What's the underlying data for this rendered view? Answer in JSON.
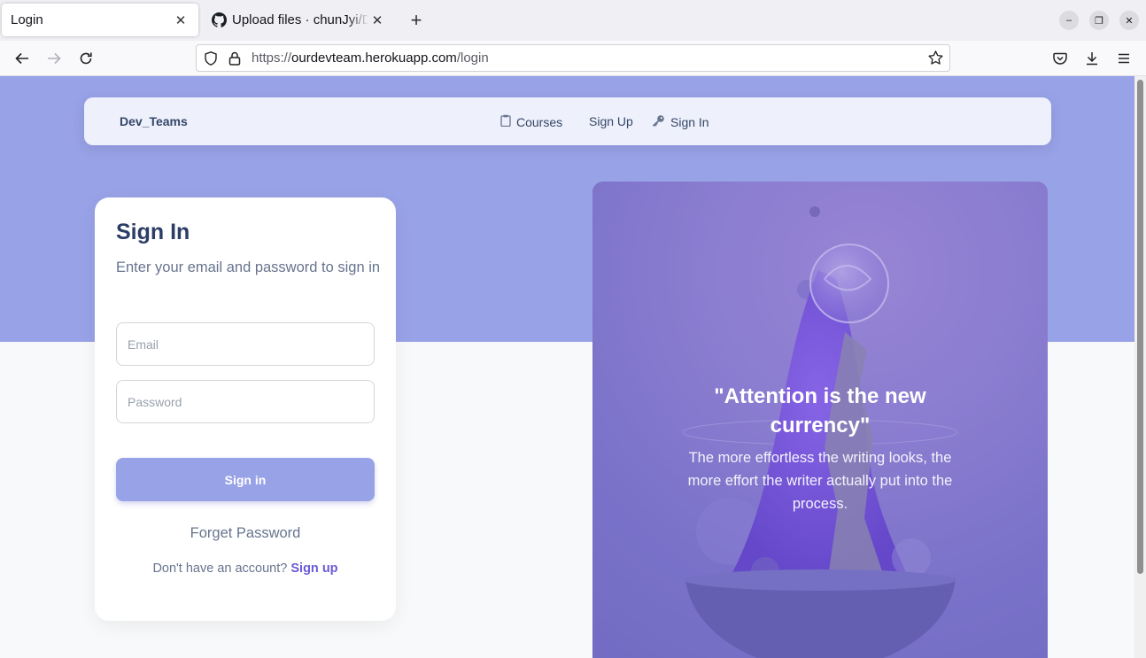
{
  "browser": {
    "tabs": [
      {
        "title": "Login",
        "active": true,
        "icon": "page-icon"
      },
      {
        "title": "Upload files · chunJyi/Dev",
        "active": false,
        "icon": "github-icon"
      }
    ],
    "url": {
      "scheme": "https://",
      "host": "ourdevteam.herokuapp.com",
      "path": "/login"
    }
  },
  "site": {
    "brand": "Dev_Teams",
    "nav": {
      "courses": "Courses",
      "signup": "Sign Up",
      "signin": "Sign In"
    }
  },
  "login": {
    "title": "Sign In",
    "subtitle": "Enter your email and password to sign in",
    "email_placeholder": "Email",
    "password_placeholder": "Password",
    "submit_label": "Sign in",
    "forgot_label": "Forget Password",
    "no_account_text": "Don't have an account?",
    "signup_link": "Sign up"
  },
  "promo": {
    "quote": "\"Attention is the new currency\"",
    "text": "The more effortless the writing looks, the more effort the writer actually put into the process."
  },
  "colors": {
    "accent": "#98a2e6",
    "link": "#6a5ad6",
    "text": "#344767"
  }
}
